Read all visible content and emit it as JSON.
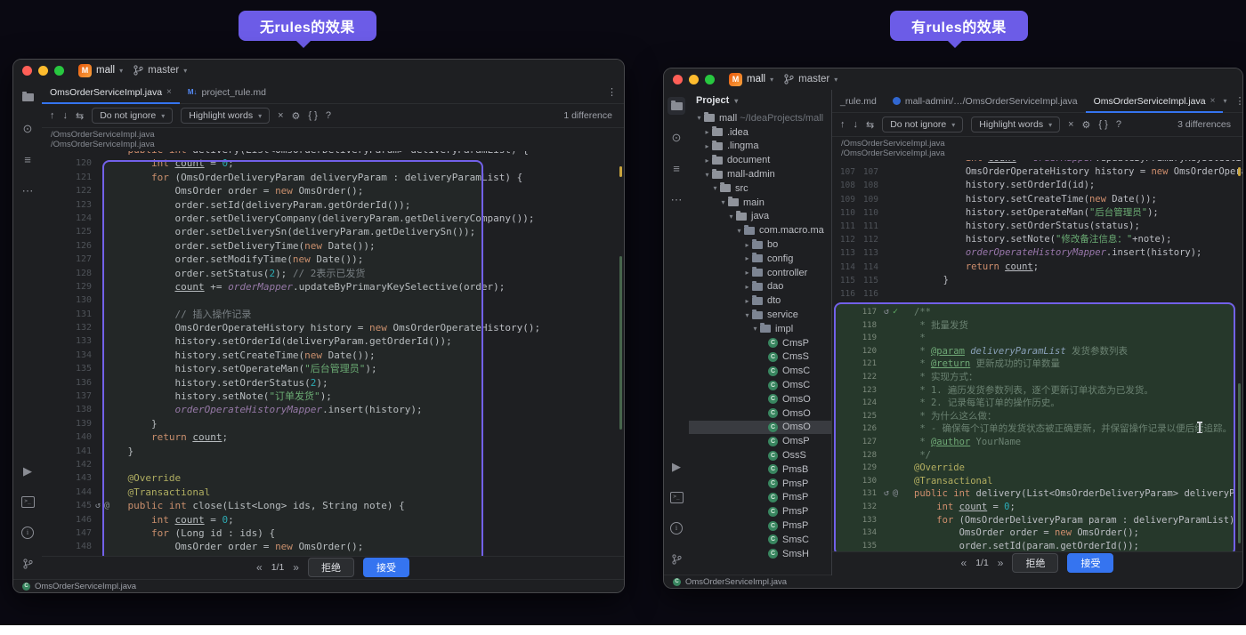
{
  "banners": {
    "left_label": "无rules的效果",
    "right_label": "有rules的效果",
    "bg": "#6c5ce7"
  },
  "icons": {
    "up": "↑",
    "down": "↓",
    "link": "⇆",
    "close": "×",
    "gear": "⚙",
    "braces": "{ }",
    "help": "?",
    "kebab": "⋮",
    "chevdown": "▾",
    "chevright": "▸",
    "undo": "↺",
    "check": "✓",
    "at": "@",
    "commit": "⊙",
    "structure": "≡",
    "more": "⋯",
    "run": "▶",
    "terminal": ">_",
    "info": "i",
    "class_letter": "C",
    "project_letter": "M",
    "md": "M↓"
  },
  "left_window": {
    "titlebar": {
      "project": "mall",
      "branch": "master"
    },
    "tabs": [
      {
        "label": "OmsOrderServiceImpl.java",
        "close": "×"
      },
      {
        "label": "project_rule.md"
      }
    ],
    "toolbar": {
      "ignore_label": "Do not ignore",
      "highlight_label": "Highlight words",
      "diff_count": "1 difference"
    },
    "paths": {
      "a": "/OmsOrderServiceImpl.java",
      "b": "/OmsOrderServiceImpl.java"
    },
    "controls": {
      "prev": "«",
      "counter": "1/1",
      "next": "»",
      "reject": "拒绝",
      "accept": "接受"
    },
    "status_file": "OmsOrderServiceImpl.java",
    "code_lines": [
      {
        "n": "",
        "t": "    public int delivery(List<OmsOrderDeliveryParam> deliveryParamList) {",
        "partial": true
      },
      {
        "n": "120",
        "t": "        int count = 0;"
      },
      {
        "n": "121",
        "t": "        for (OmsOrderDeliveryParam deliveryParam : deliveryParamList) {"
      },
      {
        "n": "122",
        "t": "            OmsOrder order = new OmsOrder();"
      },
      {
        "n": "123",
        "t": "            order.setId(deliveryParam.getOrderId());"
      },
      {
        "n": "124",
        "t": "            order.setDeliveryCompany(deliveryParam.getDeliveryCompany());"
      },
      {
        "n": "125",
        "t": "            order.setDeliverySn(deliveryParam.getDeliverySn());"
      },
      {
        "n": "126",
        "t": "            order.setDeliveryTime(new Date());"
      },
      {
        "n": "127",
        "t": "            order.setModifyTime(new Date());"
      },
      {
        "n": "128",
        "t": "            order.setStatus(2); // 2表示已发货"
      },
      {
        "n": "129",
        "t": "            count += orderMapper.updateByPrimaryKeySelective(order);"
      },
      {
        "n": "130",
        "t": ""
      },
      {
        "n": "131",
        "t": "            // 插入操作记录"
      },
      {
        "n": "132",
        "t": "            OmsOrderOperateHistory history = new OmsOrderOperateHistory();"
      },
      {
        "n": "133",
        "t": "            history.setOrderId(deliveryParam.getOrderId());"
      },
      {
        "n": "134",
        "t": "            history.setCreateTime(new Date());"
      },
      {
        "n": "135",
        "t": "            history.setOperateMan(\"后台管理员\");"
      },
      {
        "n": "136",
        "t": "            history.setOrderStatus(2);"
      },
      {
        "n": "137",
        "t": "            history.setNote(\"订单发货\");"
      },
      {
        "n": "138",
        "t": "            orderOperateHistoryMapper.insert(history);"
      },
      {
        "n": "139",
        "t": "        }"
      },
      {
        "n": "140",
        "t": "        return count;"
      },
      {
        "n": "141",
        "t": "    }"
      },
      {
        "n": "142",
        "t": ""
      },
      {
        "n": "143",
        "t": "    @Override"
      },
      {
        "n": "144",
        "t": "    @Transactional"
      },
      {
        "n": "145",
        "t": "    public int close(List<Long> ids, String note) {",
        "g": "undo-at"
      },
      {
        "n": "146",
        "t": "        int count = 0;"
      },
      {
        "n": "147",
        "t": "        for (Long id : ids) {"
      },
      {
        "n": "148",
        "t": "            OmsOrder order = new OmsOrder();"
      }
    ]
  },
  "right_window": {
    "titlebar": {
      "project": "mall",
      "branch": "master"
    },
    "project_panel": {
      "header": "Project",
      "items": [
        {
          "lvl": 0,
          "chev": "v",
          "icon": "folder",
          "label": "mall",
          "sub": "~/IdeaProjects/mall"
        },
        {
          "lvl": 1,
          "chev": ">",
          "icon": "folder",
          "label": ".idea"
        },
        {
          "lvl": 1,
          "chev": ">",
          "icon": "folder",
          "label": ".lingma"
        },
        {
          "lvl": 1,
          "chev": ">",
          "icon": "folder",
          "label": "document"
        },
        {
          "lvl": 1,
          "chev": "v",
          "icon": "folder",
          "label": "mall-admin"
        },
        {
          "lvl": 2,
          "chev": "v",
          "icon": "folder",
          "label": "src"
        },
        {
          "lvl": 3,
          "chev": "v",
          "icon": "folder",
          "label": "main"
        },
        {
          "lvl": 4,
          "chev": "v",
          "icon": "folder",
          "label": "java"
        },
        {
          "lvl": 5,
          "chev": "v",
          "icon": "pkg",
          "label": "com.macro.ma"
        },
        {
          "lvl": 6,
          "chev": ">",
          "icon": "pkg",
          "label": "bo"
        },
        {
          "lvl": 6,
          "chev": ">",
          "icon": "pkg",
          "label": "config"
        },
        {
          "lvl": 6,
          "chev": ">",
          "icon": "pkg",
          "label": "controller"
        },
        {
          "lvl": 6,
          "chev": ">",
          "icon": "pkg",
          "label": "dao"
        },
        {
          "lvl": 6,
          "chev": ">",
          "icon": "pkg",
          "label": "dto"
        },
        {
          "lvl": 6,
          "chev": "v",
          "icon": "pkg",
          "label": "service"
        },
        {
          "lvl": 7,
          "chev": "v",
          "icon": "pkg",
          "label": "impl"
        },
        {
          "lvl": 8,
          "icon": "class",
          "label": "CmsP"
        },
        {
          "lvl": 8,
          "icon": "class",
          "label": "CmsS"
        },
        {
          "lvl": 8,
          "icon": "class",
          "label": "OmsC"
        },
        {
          "lvl": 8,
          "icon": "class",
          "label": "OmsC"
        },
        {
          "lvl": 8,
          "icon": "class",
          "label": "OmsO"
        },
        {
          "lvl": 8,
          "icon": "class",
          "label": "OmsO"
        },
        {
          "lvl": 8,
          "icon": "class",
          "label": "OmsO",
          "selected": true
        },
        {
          "lvl": 8,
          "icon": "class",
          "label": "OmsP"
        },
        {
          "lvl": 8,
          "icon": "class",
          "label": "OssS"
        },
        {
          "lvl": 8,
          "icon": "class",
          "label": "PmsB"
        },
        {
          "lvl": 8,
          "icon": "class",
          "label": "PmsP"
        },
        {
          "lvl": 8,
          "icon": "class",
          "label": "PmsP"
        },
        {
          "lvl": 8,
          "icon": "class",
          "label": "PmsP"
        },
        {
          "lvl": 8,
          "icon": "class",
          "label": "PmsP"
        },
        {
          "lvl": 8,
          "icon": "class",
          "label": "SmsC"
        },
        {
          "lvl": 8,
          "icon": "class",
          "label": "SmsH"
        }
      ]
    },
    "tabs": [
      {
        "label": "_rule.md"
      },
      {
        "label": "mall-admin/…/OmsOrderServiceImpl.java"
      },
      {
        "label": "OmsOrderServiceImpl.java",
        "close": "×"
      }
    ],
    "toolbar": {
      "ignore_label": "Do not ignore",
      "highlight_label": "Highlight words",
      "diff_count": "3 differences"
    },
    "paths": {
      "a": "/OmsOrderServiceImpl.java",
      "b": "/OmsOrderServiceImpl.java"
    },
    "controls": {
      "prev": "«",
      "counter": "1/1",
      "next": "»",
      "reject": "拒绝",
      "accept": "接受"
    },
    "status_file": "OmsOrderServiceImpl.java",
    "code_top": [
      {
        "nl": "",
        "nr": "",
        "t": "            int count = orderMapper.updateByPrimaryKeySelective(order);",
        "partial": true
      },
      {
        "nl": "107",
        "nr": "107",
        "t": "            OmsOrderOperateHistory history = new OmsOrderOperateHistory();"
      },
      {
        "nl": "108",
        "nr": "108",
        "t": "            history.setOrderId(id);"
      },
      {
        "nl": "109",
        "nr": "109",
        "t": "            history.setCreateTime(new Date());"
      },
      {
        "nl": "110",
        "nr": "110",
        "t": "            history.setOperateMan(\"后台管理员\");"
      },
      {
        "nl": "111",
        "nr": "111",
        "t": "            history.setOrderStatus(status);"
      },
      {
        "nl": "112",
        "nr": "112",
        "t": "            history.setNote(\"修改备注信息：\"+note);"
      },
      {
        "nl": "113",
        "nr": "113",
        "t": "            orderOperateHistoryMapper.insert(history);"
      },
      {
        "nl": "114",
        "nr": "114",
        "t": "            return count;"
      },
      {
        "nl": "115",
        "nr": "115",
        "t": "        }"
      },
      {
        "nl": "116",
        "nr": "116",
        "t": ""
      }
    ],
    "code_block": [
      {
        "n": "117",
        "t": "/**",
        "k": "doc",
        "g": "undo-check"
      },
      {
        "n": "118",
        "t": " * 批量发货",
        "k": "doc"
      },
      {
        "n": "119",
        "t": " *",
        "k": "doc"
      },
      {
        "n": "120",
        "t": " * @param deliveryParamList 发货参数列表",
        "k": "doc"
      },
      {
        "n": "121",
        "t": " * @return 更新成功的订单数量",
        "k": "doc"
      },
      {
        "n": "122",
        "t": " * 实现方式：",
        "k": "doc"
      },
      {
        "n": "123",
        "t": " * 1. 遍历发货参数列表，逐个更新订单状态为已发货。",
        "k": "doc"
      },
      {
        "n": "124",
        "t": " * 2. 记录每笔订单的操作历史。",
        "k": "doc"
      },
      {
        "n": "125",
        "t": " * 为什么这么做：",
        "k": "doc"
      },
      {
        "n": "126",
        "t": " * - 确保每个订单的发货状态被正确更新，并保留操作记录以便后续追踪。",
        "k": "doc"
      },
      {
        "n": "127",
        "t": " * @author YourName",
        "k": "doc"
      },
      {
        "n": "128",
        "t": " */",
        "k": "doc"
      },
      {
        "n": "129",
        "t": "@Override"
      },
      {
        "n": "130",
        "t": "@Transactional"
      },
      {
        "n": "131",
        "t": "public int delivery(List<OmsOrderDeliveryParam> deliveryParamList) {",
        "g": "undo-at"
      },
      {
        "n": "132",
        "t": "    int count = 0;"
      },
      {
        "n": "133",
        "t": "    for (OmsOrderDeliveryParam param : deliveryParamList) {"
      },
      {
        "n": "134",
        "t": "        OmsOrder order = new OmsOrder();"
      },
      {
        "n": "135",
        "t": "        order.setId(param.getOrderId());"
      }
    ]
  }
}
